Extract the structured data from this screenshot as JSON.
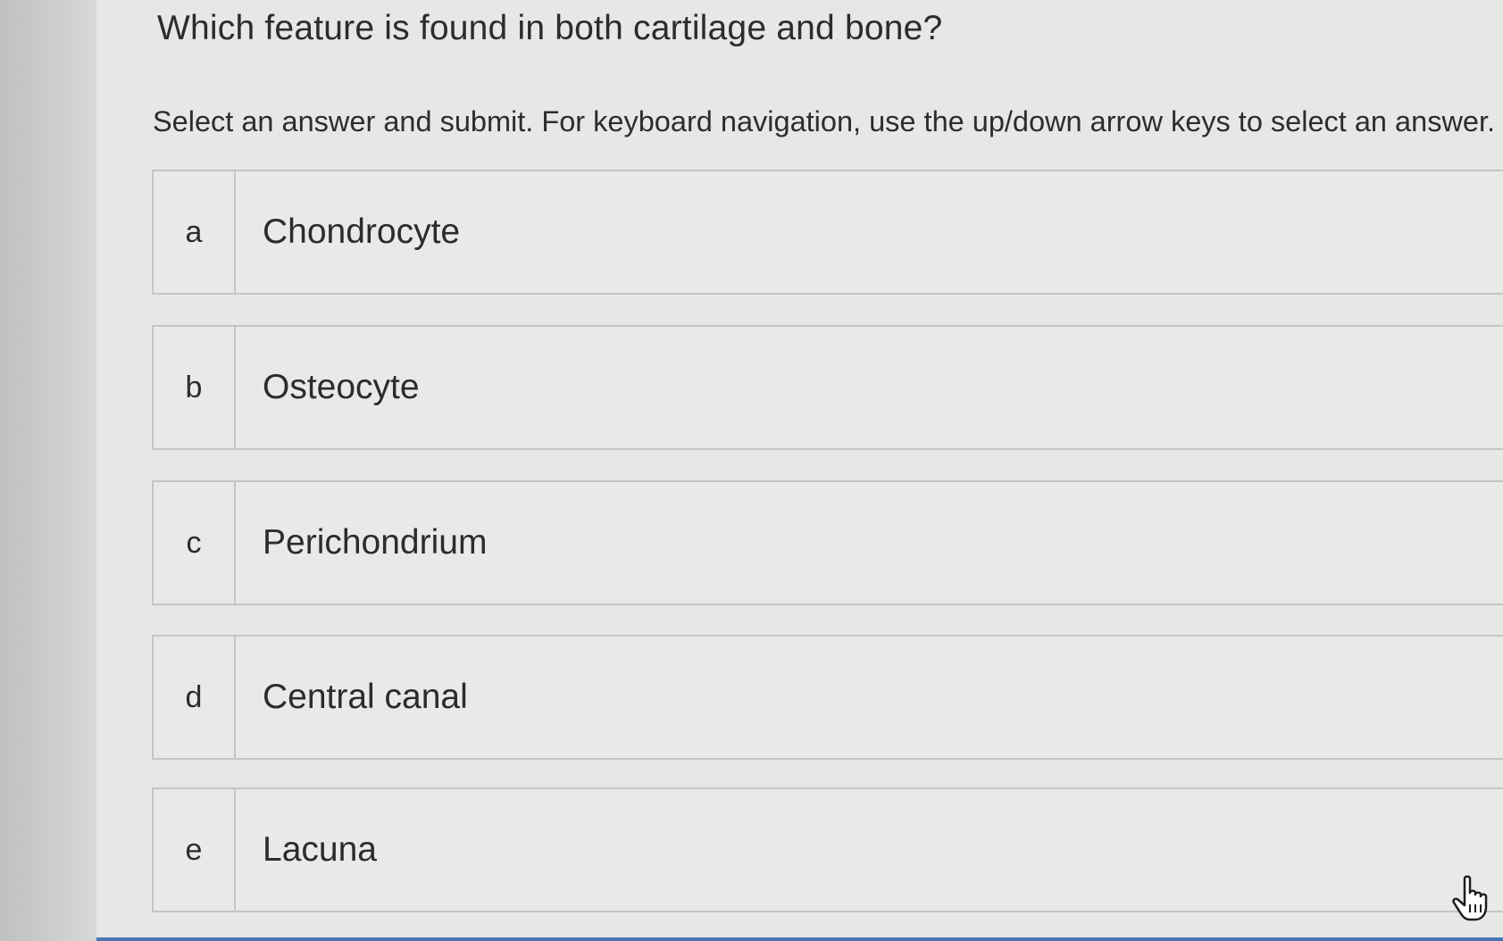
{
  "question": {
    "text": "Which feature is found in both cartilage and bone?",
    "instruction": "Select an answer and submit. For keyboard navigation, use the up/down arrow keys to select an answer."
  },
  "options": [
    {
      "letter": "a",
      "label": "Chondrocyte"
    },
    {
      "letter": "b",
      "label": "Osteocyte"
    },
    {
      "letter": "c",
      "label": "Perichondrium"
    },
    {
      "letter": "d",
      "label": "Central canal"
    },
    {
      "letter": "e",
      "label": "Lacuna"
    }
  ],
  "colors": {
    "background": "#e6e8e5",
    "border": "#c3c6c2",
    "text": "#2a2c2d",
    "accent": "#4a78b5"
  },
  "icons": {
    "cursor": "hand-pointer-icon"
  }
}
